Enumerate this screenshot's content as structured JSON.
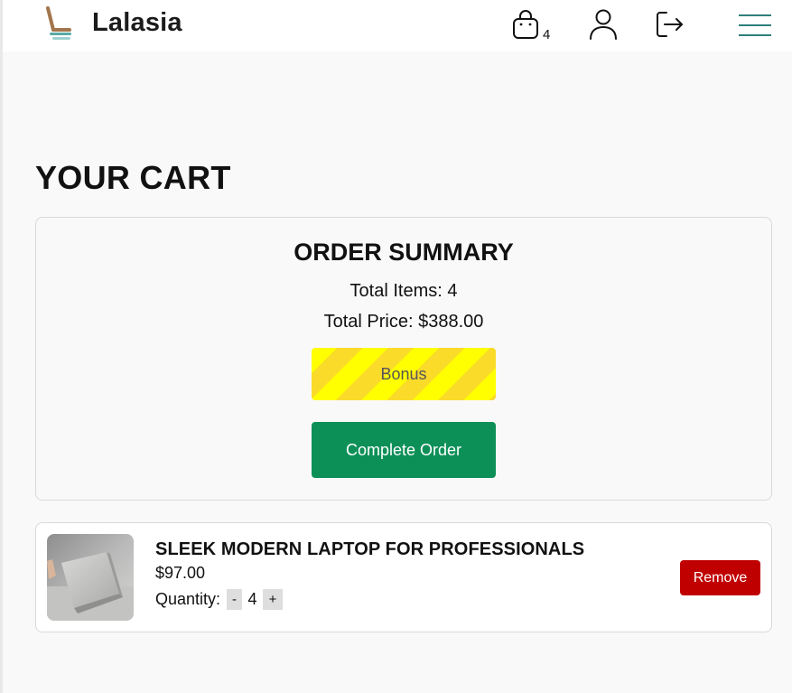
{
  "header": {
    "brand": "Lalasia",
    "cart_count": "4",
    "icons": [
      "logo-icon",
      "shopping-bag-icon",
      "user-icon",
      "logout-icon",
      "menu-icon"
    ]
  },
  "page": {
    "title": "YOUR CART"
  },
  "summary": {
    "title": "ORDER SUMMARY",
    "total_items": "Total Items: 4",
    "total_price": "Total Price: $388.00",
    "bonus_label": "Bonus",
    "complete_label": "Complete Order"
  },
  "cart_items": [
    {
      "name": "SLEEK MODERN LAPTOP FOR PROFESSIONALS",
      "price": "$97.00",
      "quantity_label": "Quantity:",
      "decrement": "-",
      "quantity": "4",
      "increment": "+",
      "remove_label": "Remove"
    }
  ],
  "colors": {
    "primary": "#0d9058",
    "danger": "#c00000",
    "bonus_stripe_a": "#ffff00",
    "bonus_stripe_b": "#fadb2a",
    "background": "#f9f9f9"
  }
}
